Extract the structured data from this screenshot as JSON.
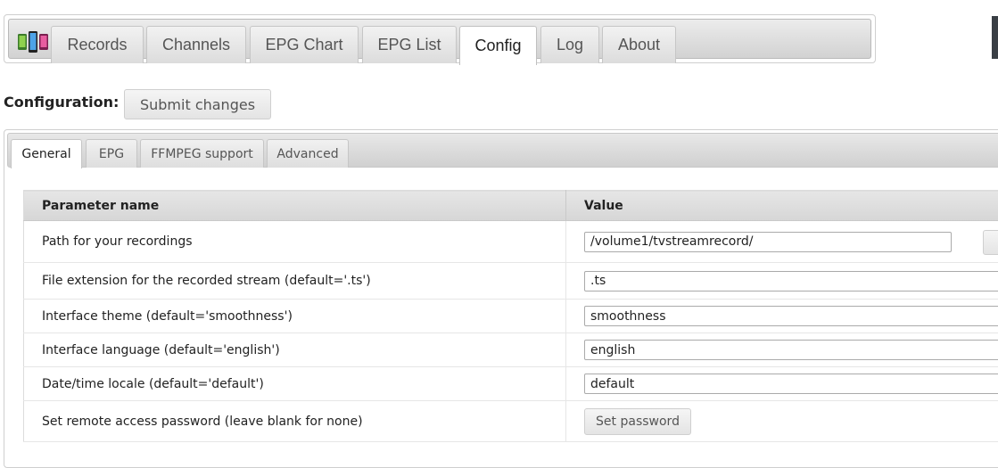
{
  "nav": {
    "logo": "phones-logo-icon",
    "tabs": [
      {
        "label": "Records"
      },
      {
        "label": "Channels"
      },
      {
        "label": "EPG Chart"
      },
      {
        "label": "EPG List"
      },
      {
        "label": "Config",
        "active": true
      },
      {
        "label": "Log"
      },
      {
        "label": "About"
      }
    ]
  },
  "config": {
    "heading": "Configuration:",
    "submit_label": "Submit changes",
    "tabs": [
      {
        "label": "General",
        "active": true
      },
      {
        "label": "EPG"
      },
      {
        "label": "FFMPEG support"
      },
      {
        "label": "Advanced"
      }
    ],
    "table": {
      "headers": {
        "param": "Parameter name",
        "value": "Value"
      },
      "rows": [
        {
          "param": "Path for your recordings",
          "value": "/volume1/tvstreamrecord/"
        },
        {
          "param": "File extension for the recorded stream (default='.ts')",
          "value": ".ts"
        },
        {
          "param": "Interface theme (default='smoothness')",
          "value": "smoothness"
        },
        {
          "param": "Interface language (default='english')",
          "value": "english"
        },
        {
          "param": "Date/time locale (default='default')",
          "value": "default"
        },
        {
          "param": "Set remote access password (leave blank for none)",
          "button_label": "Set password"
        }
      ]
    }
  }
}
